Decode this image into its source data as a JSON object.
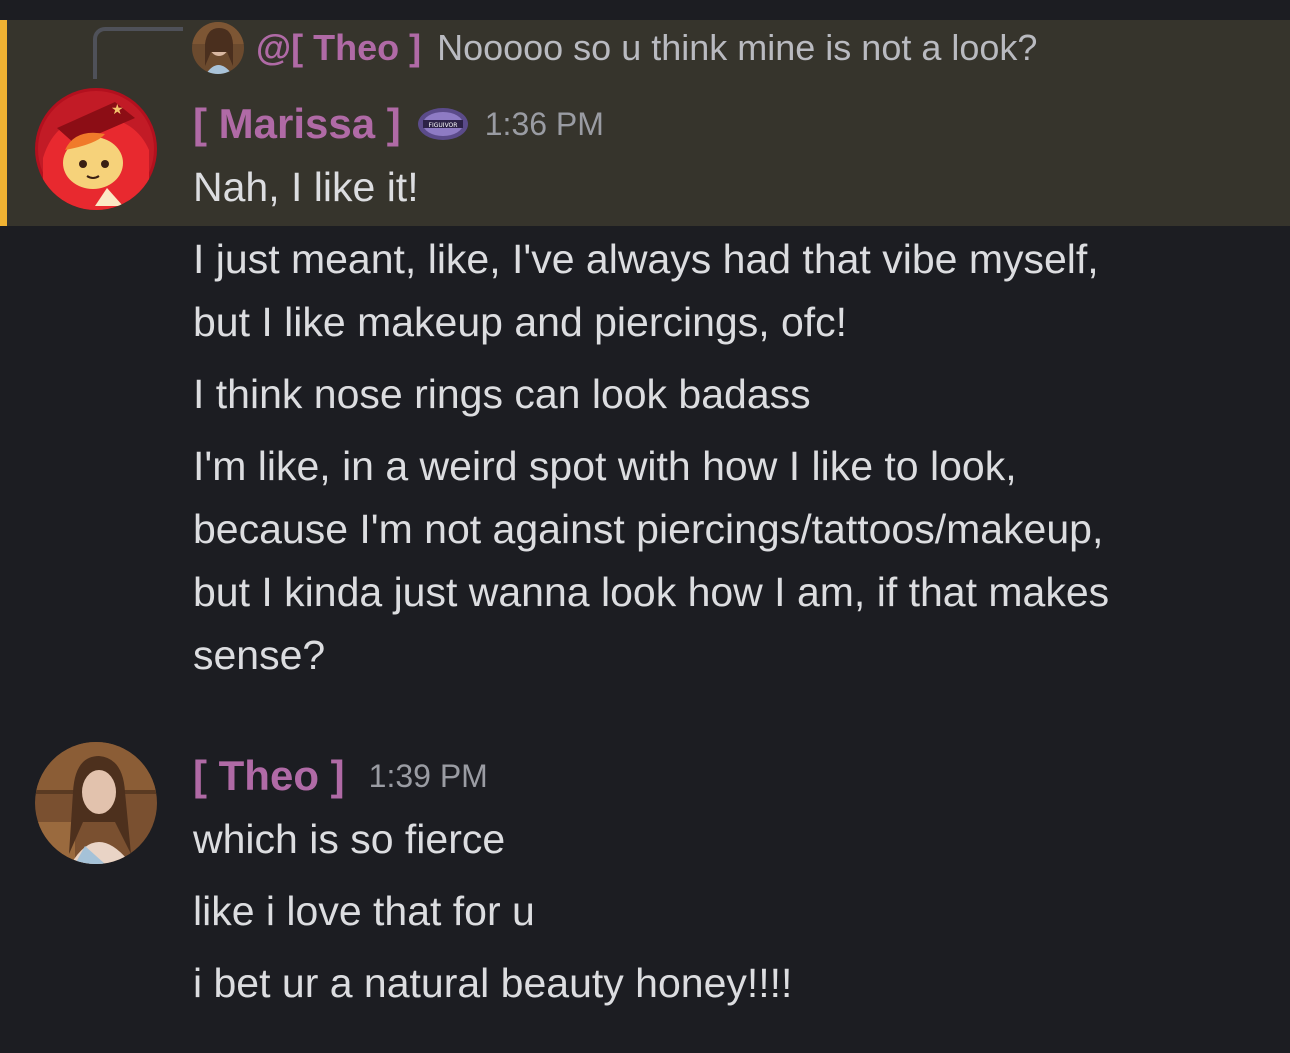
{
  "reply": {
    "mention_name": "@[ Theo ]",
    "text": "Nooooo so u think mine is not a look?"
  },
  "messages": [
    {
      "author": "[ Marissa ]",
      "badge_text": "FIGUIVOR",
      "time": "1:36 PM",
      "lines": [
        "Nah, I like it!",
        "I just meant, like, I've always had that vibe myself,",
        "but I like makeup and piercings, ofc!",
        "I think nose rings can look badass",
        "I'm like, in a weird spot with how I like to look,",
        "because I'm not against piercings/tattoos/makeup,",
        "but I kinda just wanna look how I am, if that makes",
        "sense?"
      ]
    },
    {
      "author": "[ Theo ]",
      "time": "1:39 PM",
      "lines": [
        "which is so fierce",
        "like i love that for u",
        "i bet ur a natural beauty honey!!!!"
      ]
    }
  ],
  "colors": {
    "background": "#1c1d22",
    "highlight_background": "#36342c",
    "highlight_bar": "#f0b232",
    "username": "#b06aa6",
    "timestamp": "#9a9ca3",
    "text": "#dcdde0"
  }
}
